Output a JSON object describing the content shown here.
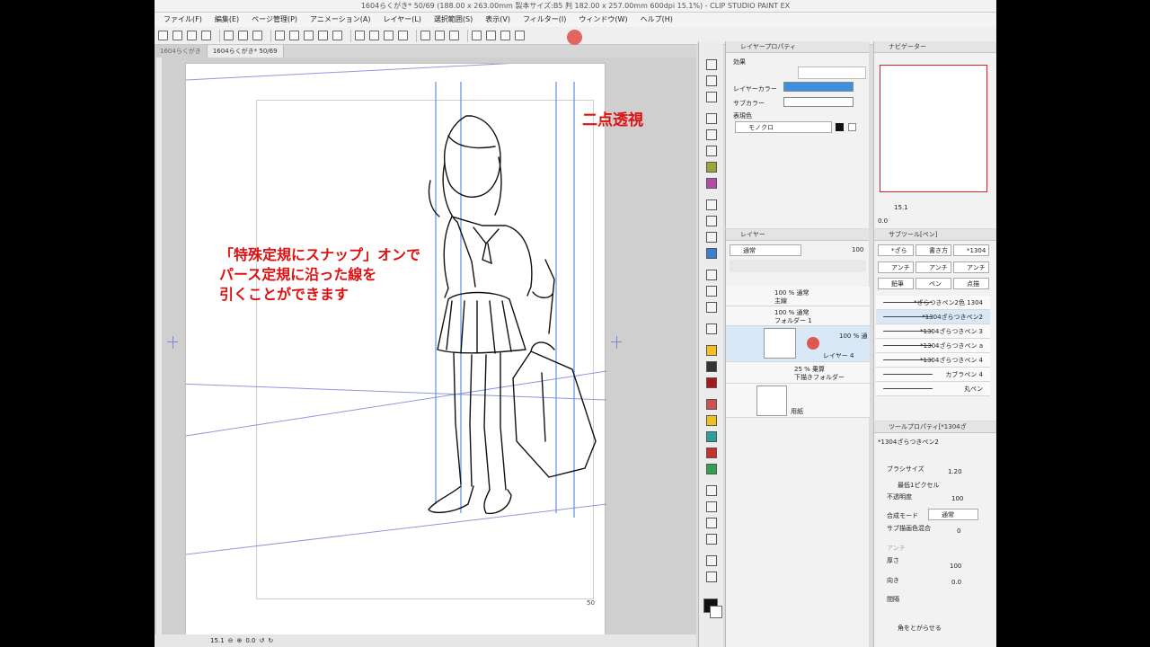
{
  "window": {
    "title": "1604らくがき* 50/69 (188.00 x 263.00mm 製本サイズ:B5 判 182.00 x 257.00mm 600dpi 15.1%) - CLIP STUDIO PAINT EX"
  },
  "menu": [
    "ファイル(F)",
    "編集(E)",
    "ページ管理(P)",
    "アニメーション(A)",
    "レイヤー(L)",
    "選択範囲(S)",
    "表示(V)",
    "フィルター(I)",
    "ウィンドウ(W)",
    "ヘルプ(H)"
  ],
  "tabs": [
    "1604らくがき",
    "1604らくがき* 50/69"
  ],
  "canvas": {
    "note_title": "二点透視",
    "note_body": "「特殊定規にスナップ」オンで\nパース定規に沿った線を\n引くことができます",
    "page_number": "50"
  },
  "status": {
    "zoom": "15.1",
    "angle": "0.0"
  },
  "layer_property": {
    "title": "レイヤープロパティ",
    "effect_label": "効果",
    "layer_color_label": "レイヤーカラー",
    "sub_color_label": "サブカラー",
    "expression_color_label": "表現色",
    "expression_color_value": "モノクロ",
    "layer_color": "#3d8fe0"
  },
  "layers_panel": {
    "title": "レイヤー",
    "blend_mode": "通常",
    "opacity": "100",
    "rows": [
      {
        "line1": "100 % 通常",
        "line2": "主線"
      },
      {
        "line1": "100 % 通常",
        "line2": "フォルダー 1"
      },
      {
        "line1": "100 % 通",
        "line2": "レイヤー 4"
      },
      {
        "line1": "25 % 乗算",
        "line2": "下描きフォルダー"
      },
      {
        "line1": "",
        "line2": "用紙"
      }
    ]
  },
  "navigator": {
    "title": "ナビゲーター",
    "zoom": "15.1",
    "angle": "0.0"
  },
  "subtool": {
    "title": "サブツール[ペン]",
    "groups": [
      "*ざら",
      "書き方",
      "*1304",
      "アンチ",
      "アンチ",
      "アンチ",
      "鉛筆",
      "ペン",
      "点描"
    ],
    "brushes": [
      "*ざらつきペン2色 1304",
      "*1304ざらつきペン2",
      "*1304ざらつきペン 3",
      "*1304ざらつきペン a",
      "*1304ざらつきペン 4",
      "カブラペン 4",
      "丸ペン"
    ]
  },
  "tool_property": {
    "title": "ツールプロパティ[*1304ざ",
    "tool_name": "*1304ざらつきペン2",
    "brush_size_label": "ブラシサイズ",
    "brush_size": "1.20",
    "min_pixel_label": "最低1ピクセル",
    "opacity_label": "不透明度",
    "opacity": "100",
    "blend_label": "合成モード",
    "blend_value": "通常",
    "sub_draw_label": "サブ描画色混合",
    "sub_draw_value": "0",
    "anti_label": "アンチ",
    "thickness_label": "厚さ",
    "thickness": "100",
    "direction_label": "向き",
    "direction": "0.0",
    "interval_label": "間隔",
    "corner_label": "角をとがらせる"
  }
}
